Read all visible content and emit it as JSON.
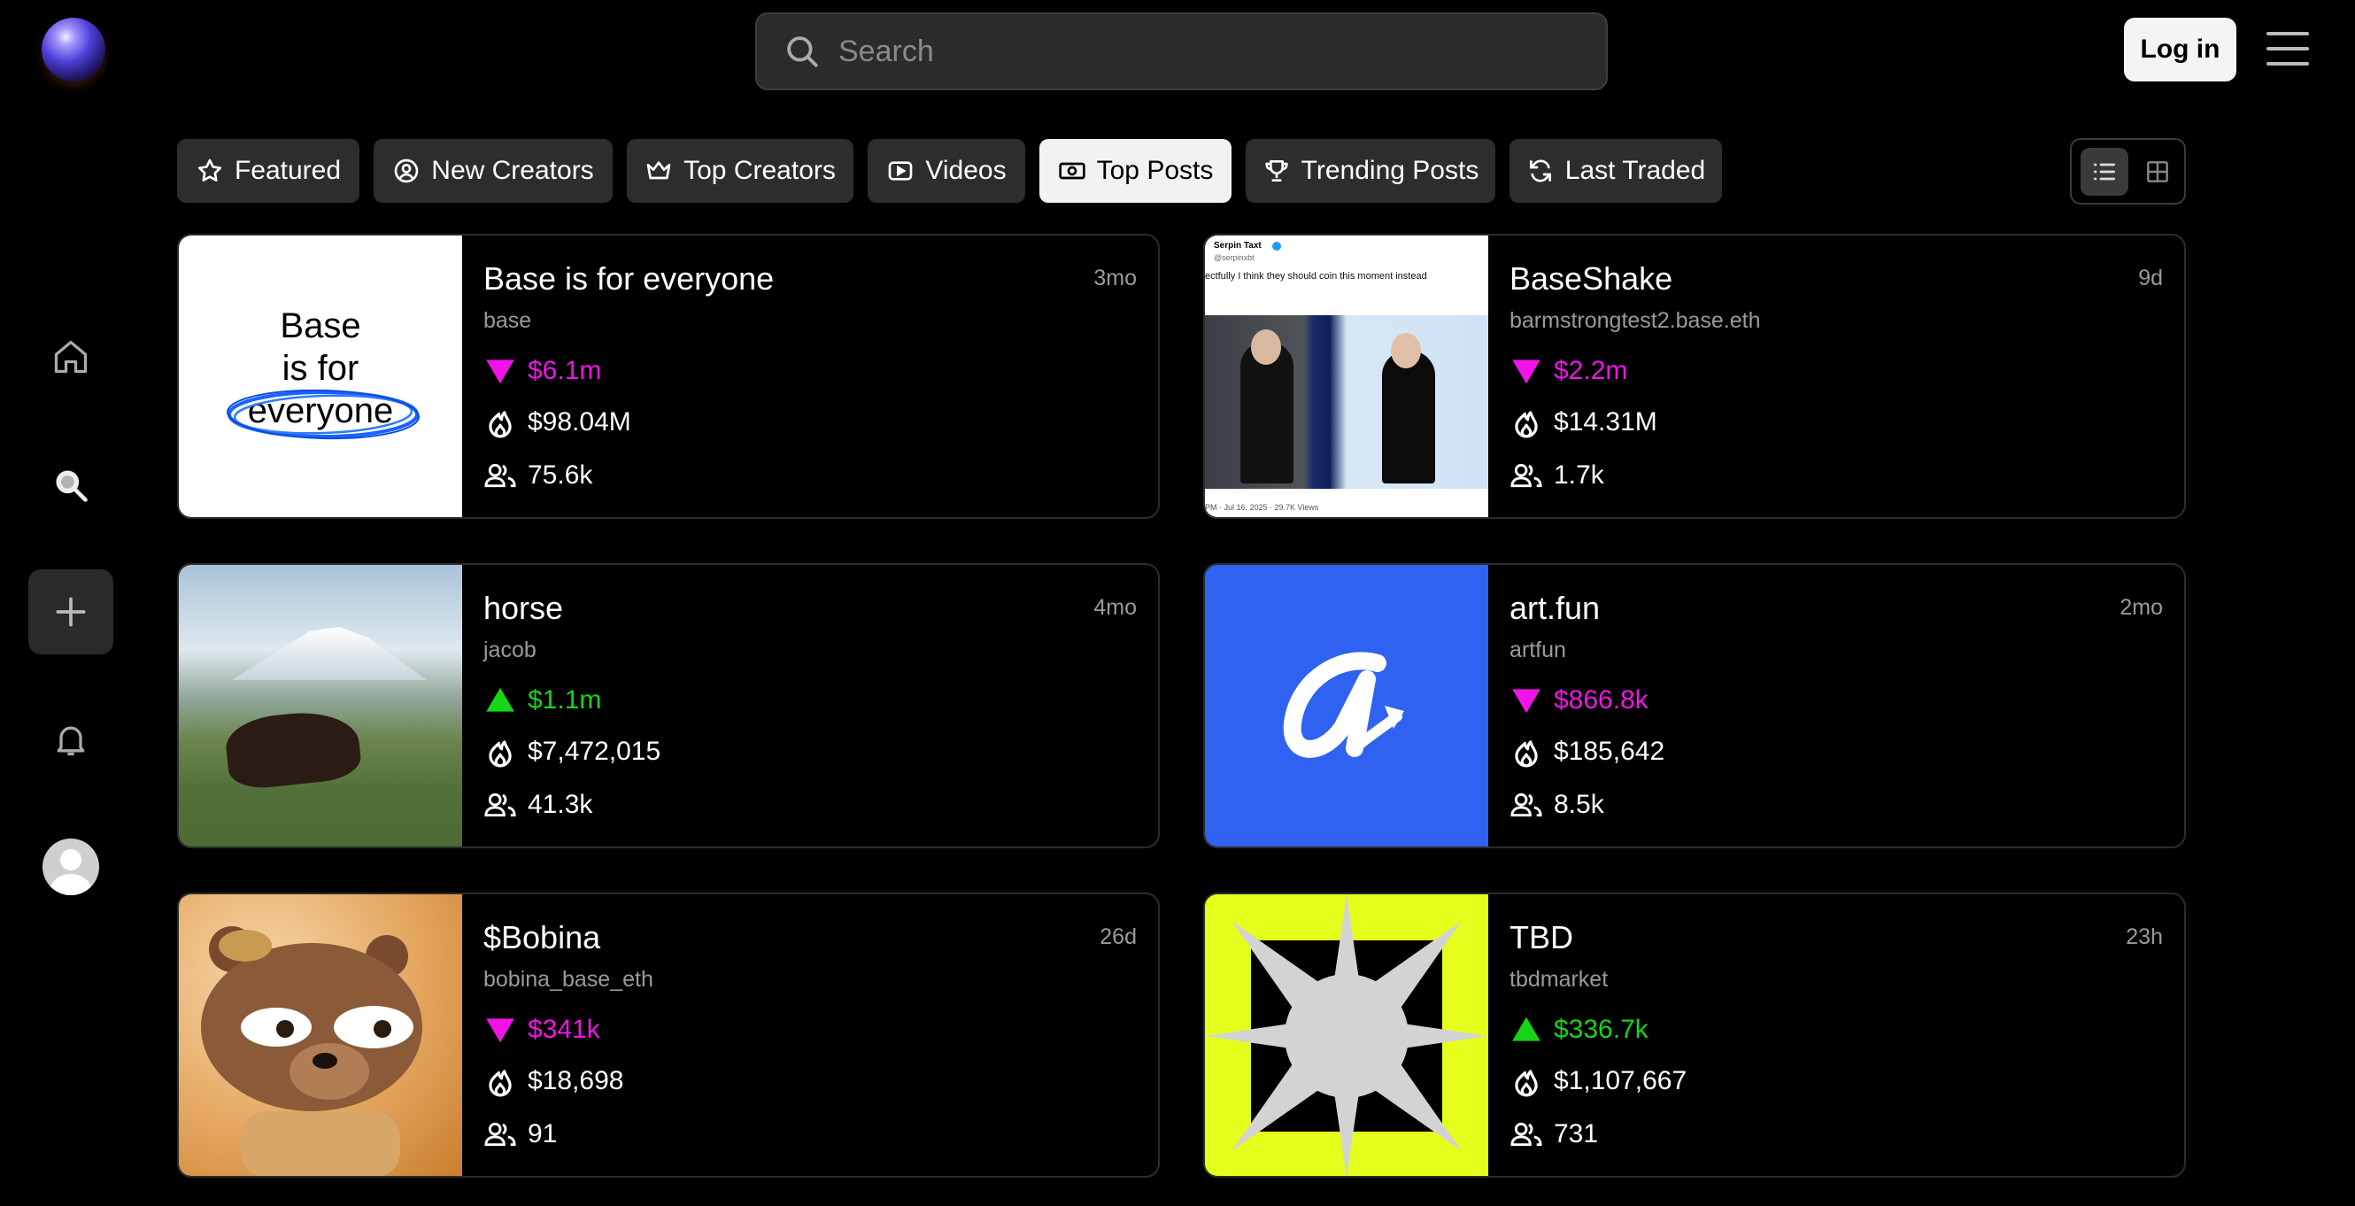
{
  "search": {
    "placeholder": "Search"
  },
  "header": {
    "login_label": "Log in"
  },
  "tabs": [
    {
      "label": "Featured",
      "icon": "star-icon"
    },
    {
      "label": "New Creators",
      "icon": "user-circle-icon"
    },
    {
      "label": "Top Creators",
      "icon": "crown-icon"
    },
    {
      "label": "Videos",
      "icon": "play-icon"
    },
    {
      "label": "Top Posts",
      "icon": "money-icon",
      "active": true
    },
    {
      "label": "Trending Posts",
      "icon": "trophy-icon"
    },
    {
      "label": "Last Traded",
      "icon": "refresh-icon"
    }
  ],
  "colors": {
    "up": "#16d616",
    "down": "#f014e8",
    "accent_blue": "#2f62f0",
    "accent_yellow": "#e5ff1c"
  },
  "cards": [
    {
      "title": "Base is for everyone",
      "handle": "base",
      "age": "3mo",
      "trend": "down",
      "market_cap": "$6.1m",
      "volume": "$98.04M",
      "holders": "75.6k",
      "thumb_text": {
        "line1": "Base",
        "line2": "is for",
        "line3": "everyone"
      }
    },
    {
      "title": "BaseShake",
      "handle": "barmstrongtest2.base.eth",
      "age": "9d",
      "trend": "down",
      "market_cap": "$2.2m",
      "volume": "$14.31M",
      "holders": "1.7k",
      "thumb_text": {
        "name": "Serpin Taxt",
        "at": "@serpinxbt",
        "tweet": "ectfully I think they should coin this moment instead",
        "footer": "PM · Jul 16, 2025 · 29.7K Views"
      }
    },
    {
      "title": "horse",
      "handle": "jacob",
      "age": "4mo",
      "trend": "up",
      "market_cap": "$1.1m",
      "volume": "$7,472,015",
      "holders": "41.3k"
    },
    {
      "title": "art.fun",
      "handle": "artfun",
      "age": "2mo",
      "trend": "down",
      "market_cap": "$866.8k",
      "volume": "$185,642",
      "holders": "8.5k"
    },
    {
      "title": "$Bobina",
      "handle": "bobina_base_eth",
      "age": "26d",
      "trend": "down",
      "market_cap": "$341k",
      "volume": "$18,698",
      "holders": "91"
    },
    {
      "title": "TBD",
      "handle": "tbdmarket",
      "age": "23h",
      "trend": "up",
      "market_cap": "$336.7k",
      "volume": "$1,107,667",
      "holders": "731"
    }
  ]
}
